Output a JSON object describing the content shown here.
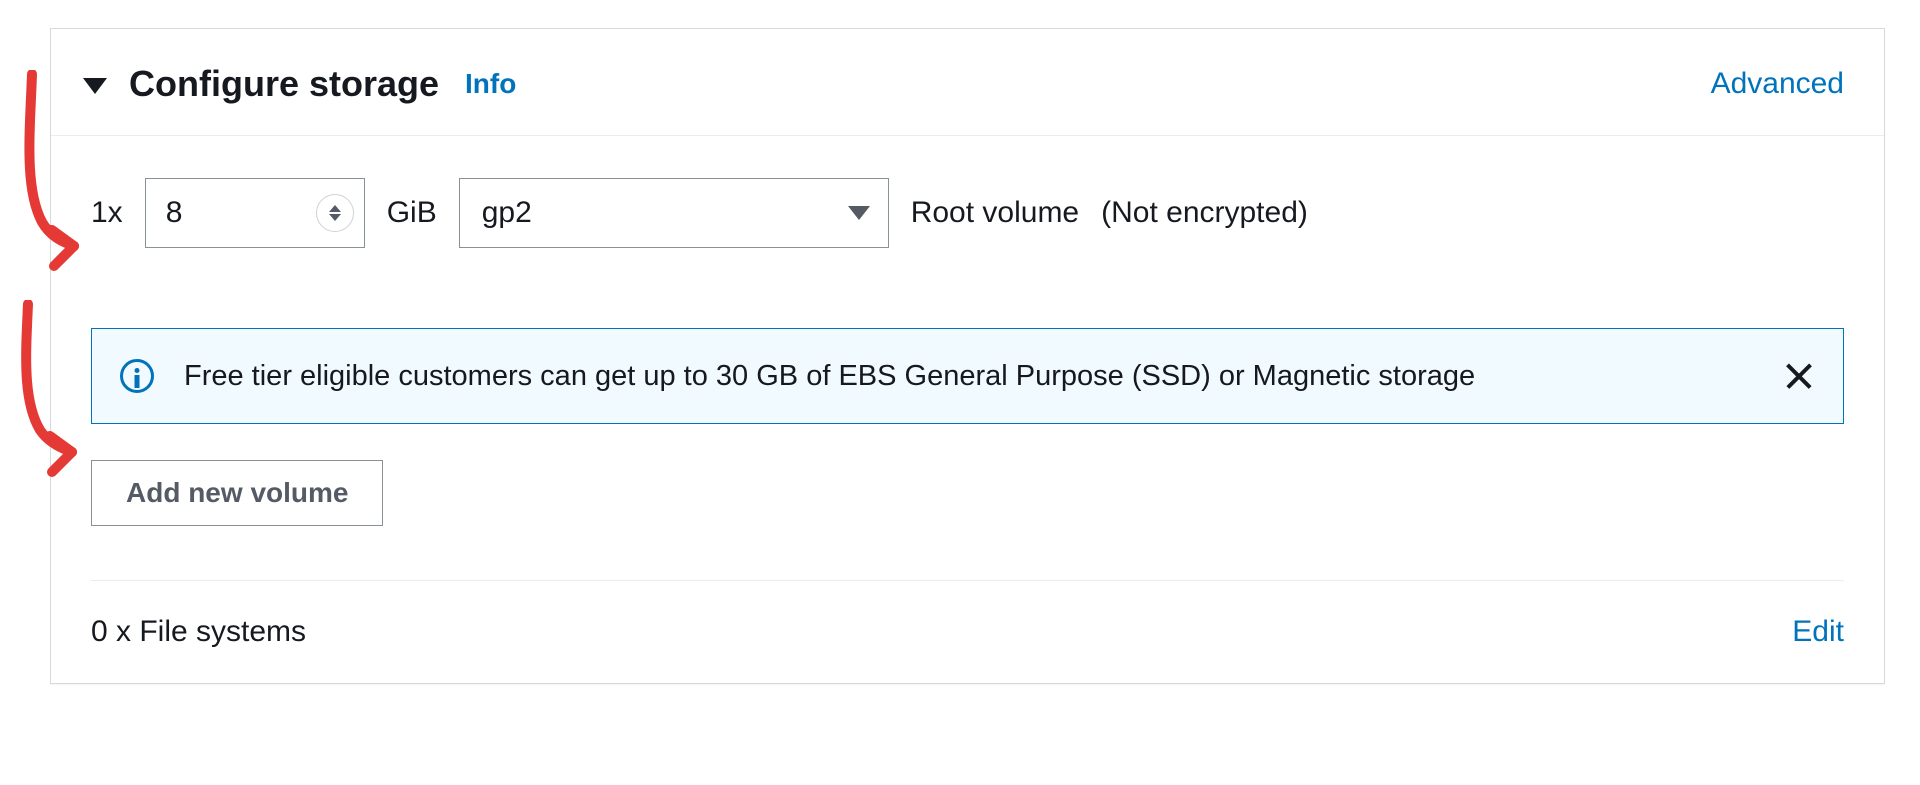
{
  "header": {
    "title": "Configure storage",
    "info_label": "Info",
    "advanced_label": "Advanced"
  },
  "volume": {
    "multiplier": "1x",
    "size": "8",
    "unit": "GiB",
    "type_selected": "gp2",
    "description": "Root volume",
    "encryption": "(Not encrypted)"
  },
  "info_box": {
    "text": "Free tier eligible customers can get up to 30 GB of EBS General Purpose (SSD) or Magnetic storage"
  },
  "actions": {
    "add_volume_label": "Add new volume"
  },
  "filesystems": {
    "summary": "0 x File systems",
    "edit_label": "Edit"
  }
}
